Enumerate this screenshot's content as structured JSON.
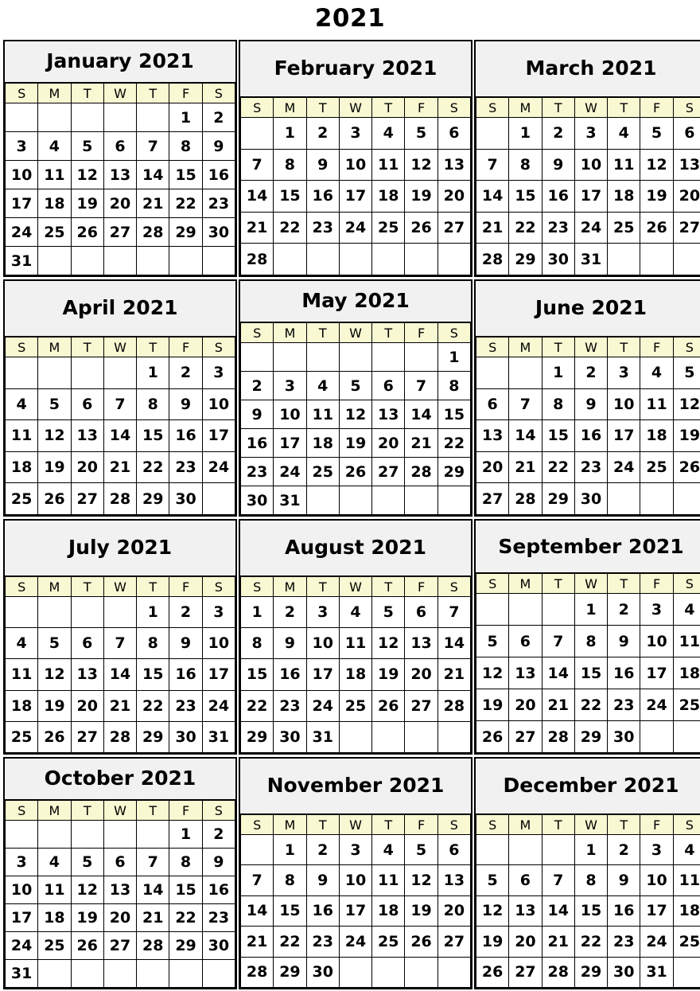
{
  "year_title": "2021",
  "weekday_headers": [
    "S",
    "M",
    "T",
    "W",
    "T",
    "F",
    "S"
  ],
  "colors": {
    "page_background": "#ffffff",
    "month_title_background": "#f1f1f1",
    "weekday_header_background": "#f8f8d2",
    "day_cell_background": "#ffffff",
    "border": "#000000",
    "text": "#000000"
  },
  "months": [
    {
      "name": "January 2021",
      "rows": 6,
      "weeks": [
        [
          "",
          "",
          "",
          "",
          "",
          "1",
          "2"
        ],
        [
          "3",
          "4",
          "5",
          "6",
          "7",
          "8",
          "9"
        ],
        [
          "10",
          "11",
          "12",
          "13",
          "14",
          "15",
          "16"
        ],
        [
          "17",
          "18",
          "19",
          "20",
          "21",
          "22",
          "23"
        ],
        [
          "24",
          "25",
          "26",
          "27",
          "28",
          "29",
          "30"
        ],
        [
          "31",
          "",
          "",
          "",
          "",
          "",
          ""
        ]
      ]
    },
    {
      "name": "February 2021",
      "rows": 5,
      "weeks": [
        [
          "",
          "1",
          "2",
          "3",
          "4",
          "5",
          "6"
        ],
        [
          "7",
          "8",
          "9",
          "10",
          "11",
          "12",
          "13"
        ],
        [
          "14",
          "15",
          "16",
          "17",
          "18",
          "19",
          "20"
        ],
        [
          "21",
          "22",
          "23",
          "24",
          "25",
          "26",
          "27"
        ],
        [
          "28",
          "",
          "",
          "",
          "",
          "",
          ""
        ]
      ]
    },
    {
      "name": "March 2021",
      "rows": 5,
      "weeks": [
        [
          "",
          "1",
          "2",
          "3",
          "4",
          "5",
          "6"
        ],
        [
          "7",
          "8",
          "9",
          "10",
          "11",
          "12",
          "13"
        ],
        [
          "14",
          "15",
          "16",
          "17",
          "18",
          "19",
          "20"
        ],
        [
          "21",
          "22",
          "23",
          "24",
          "25",
          "26",
          "27"
        ],
        [
          "28",
          "29",
          "30",
          "31",
          "",
          "",
          ""
        ]
      ]
    },
    {
      "name": "April 2021",
      "rows": 5,
      "weeks": [
        [
          "",
          "",
          "",
          "",
          "1",
          "2",
          "3"
        ],
        [
          "4",
          "5",
          "6",
          "7",
          "8",
          "9",
          "10"
        ],
        [
          "11",
          "12",
          "13",
          "14",
          "15",
          "16",
          "17"
        ],
        [
          "18",
          "19",
          "20",
          "21",
          "22",
          "23",
          "24"
        ],
        [
          "25",
          "26",
          "27",
          "28",
          "29",
          "30",
          ""
        ]
      ]
    },
    {
      "name": "May 2021",
      "rows": 6,
      "weeks": [
        [
          "",
          "",
          "",
          "",
          "",
          "",
          "1"
        ],
        [
          "2",
          "3",
          "4",
          "5",
          "6",
          "7",
          "8"
        ],
        [
          "9",
          "10",
          "11",
          "12",
          "13",
          "14",
          "15"
        ],
        [
          "16",
          "17",
          "18",
          "19",
          "20",
          "21",
          "22"
        ],
        [
          "23",
          "24",
          "25",
          "26",
          "27",
          "28",
          "29"
        ],
        [
          "30",
          "31",
          "",
          "",
          "",
          "",
          ""
        ]
      ]
    },
    {
      "name": "June 2021",
      "rows": 5,
      "weeks": [
        [
          "",
          "",
          "1",
          "2",
          "3",
          "4",
          "5"
        ],
        [
          "6",
          "7",
          "8",
          "9",
          "10",
          "11",
          "12"
        ],
        [
          "13",
          "14",
          "15",
          "16",
          "17",
          "18",
          "19"
        ],
        [
          "20",
          "21",
          "22",
          "23",
          "24",
          "25",
          "26"
        ],
        [
          "27",
          "28",
          "29",
          "30",
          "",
          "",
          ""
        ]
      ]
    },
    {
      "name": "July 2021",
      "rows": 5,
      "weeks": [
        [
          "",
          "",
          "",
          "",
          "1",
          "2",
          "3"
        ],
        [
          "4",
          "5",
          "6",
          "7",
          "8",
          "9",
          "10"
        ],
        [
          "11",
          "12",
          "13",
          "14",
          "15",
          "16",
          "17"
        ],
        [
          "18",
          "19",
          "20",
          "21",
          "22",
          "23",
          "24"
        ],
        [
          "25",
          "26",
          "27",
          "28",
          "29",
          "30",
          "31"
        ]
      ]
    },
    {
      "name": "August 2021",
      "rows": 5,
      "weeks": [
        [
          "1",
          "2",
          "3",
          "4",
          "5",
          "6",
          "7"
        ],
        [
          "8",
          "9",
          "10",
          "11",
          "12",
          "13",
          "14"
        ],
        [
          "15",
          "16",
          "17",
          "18",
          "19",
          "20",
          "21"
        ],
        [
          "22",
          "23",
          "24",
          "25",
          "26",
          "27",
          "28"
        ],
        [
          "29",
          "30",
          "31",
          "",
          "",
          "",
          ""
        ]
      ]
    },
    {
      "name": "September 2021",
      "rows": 5,
      "wrap_title": true,
      "weeks": [
        [
          "",
          "",
          "",
          "1",
          "2",
          "3",
          "4"
        ],
        [
          "5",
          "6",
          "7",
          "8",
          "9",
          "10",
          "11"
        ],
        [
          "12",
          "13",
          "14",
          "15",
          "16",
          "17",
          "18"
        ],
        [
          "19",
          "20",
          "21",
          "22",
          "23",
          "24",
          "25"
        ],
        [
          "26",
          "27",
          "28",
          "29",
          "30",
          "",
          ""
        ]
      ]
    },
    {
      "name": "October 2021",
      "rows": 6,
      "weeks": [
        [
          "",
          "",
          "",
          "",
          "",
          "1",
          "2"
        ],
        [
          "3",
          "4",
          "5",
          "6",
          "7",
          "8",
          "9"
        ],
        [
          "10",
          "11",
          "12",
          "13",
          "14",
          "15",
          "16"
        ],
        [
          "17",
          "18",
          "19",
          "20",
          "21",
          "22",
          "23"
        ],
        [
          "24",
          "25",
          "26",
          "27",
          "28",
          "29",
          "30"
        ],
        [
          "31",
          "",
          "",
          "",
          "",
          "",
          ""
        ]
      ]
    },
    {
      "name": "November 2021",
      "rows": 5,
      "weeks": [
        [
          "",
          "1",
          "2",
          "3",
          "4",
          "5",
          "6"
        ],
        [
          "7",
          "8",
          "9",
          "10",
          "11",
          "12",
          "13"
        ],
        [
          "14",
          "15",
          "16",
          "17",
          "18",
          "19",
          "20"
        ],
        [
          "21",
          "22",
          "23",
          "24",
          "25",
          "26",
          "27"
        ],
        [
          "28",
          "29",
          "30",
          "",
          "",
          "",
          ""
        ]
      ]
    },
    {
      "name": "December 2021",
      "rows": 5,
      "weeks": [
        [
          "",
          "",
          "",
          "1",
          "2",
          "3",
          "4"
        ],
        [
          "5",
          "6",
          "7",
          "8",
          "9",
          "10",
          "11"
        ],
        [
          "12",
          "13",
          "14",
          "15",
          "16",
          "17",
          "18"
        ],
        [
          "19",
          "20",
          "21",
          "22",
          "23",
          "24",
          "25"
        ],
        [
          "26",
          "27",
          "28",
          "29",
          "30",
          "31",
          ""
        ]
      ]
    }
  ]
}
